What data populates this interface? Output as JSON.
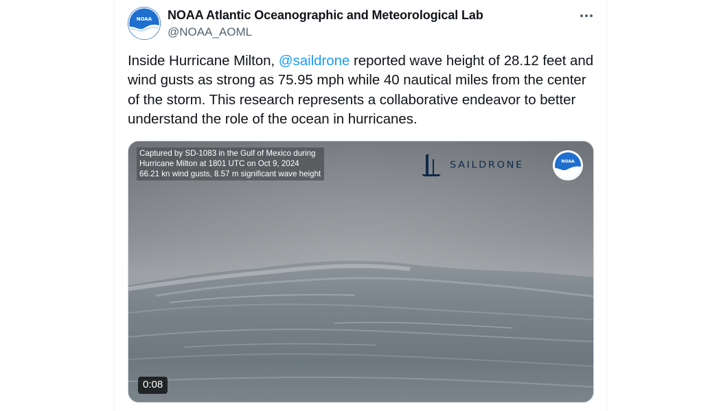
{
  "author": {
    "name": "NOAA Atlantic Oceanographic and Meteorological Lab",
    "handle": "@NOAA_AOML",
    "avatar_icon": "noaa-logo",
    "avatar_text": "NOAA"
  },
  "more_icon": "more-horizontal-icon",
  "tweet": {
    "text_part1": "Inside Hurricane Milton, ",
    "mention": "@saildrone",
    "text_part2": " reported wave height of 28.12 feet and wind gusts as strong as 75.95 mph while 40 nautical miles from the center of the storm. This research represents a collaborative endeavor to better understand the role of the ocean in hurricanes."
  },
  "media": {
    "type": "video",
    "caption_lines": [
      "Captured by SD-1083 in the Gulf of Mexico during",
      "Hurricane Milton at 1801 UTC on Oct 9, 2024",
      "66.21 kn wind gusts, 8.57 m significant wave height"
    ],
    "brand_text": "SAILDRONE",
    "noaa_badge_text": "NOAA",
    "duration": "0:08"
  },
  "colors": {
    "text_primary": "#0f1419",
    "text_secondary": "#536471",
    "link": "#1d9bf0",
    "brand_navy": "#0e2a4a",
    "noaa_blue": "#1a5fb4"
  }
}
